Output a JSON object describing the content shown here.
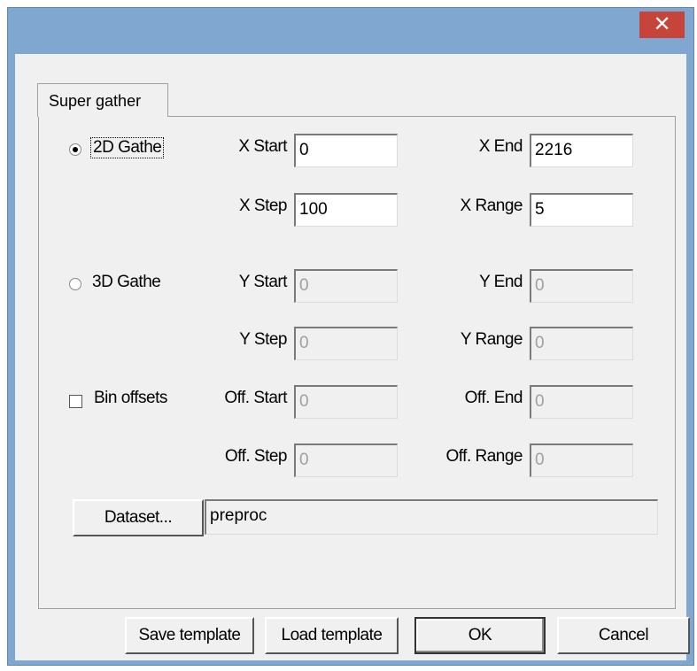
{
  "window": {
    "close_glyph": "✕"
  },
  "tabs": [
    {
      "label": "Super gather",
      "selected": true
    }
  ],
  "gather_mode": {
    "option_2d": {
      "label": "2D Gathe",
      "checked": true
    },
    "option_3d": {
      "label": "3D Gathe",
      "checked": false
    }
  },
  "x_params": {
    "start_label": "X Start",
    "start_value": "0",
    "end_label": "X End",
    "end_value": "2216",
    "step_label": "X Step",
    "step_value": "100",
    "range_label": "X Range",
    "range_value": "5"
  },
  "y_params": {
    "start_label": "Y Start",
    "start_value": "0",
    "end_label": "Y End",
    "end_value": "0",
    "step_label": "Y Step",
    "step_value": "0",
    "range_label": "Y Range",
    "range_value": "0"
  },
  "offsets": {
    "checkbox_label": "Bin offsets",
    "checked": false,
    "start_label": "Off. Start",
    "start_value": "0",
    "end_label": "Off. End",
    "end_value": "0",
    "step_label": "Off. Step",
    "step_value": "0",
    "range_label": "Off. Range",
    "range_value": "0"
  },
  "dataset": {
    "button_label": "Dataset...",
    "value": "preproc"
  },
  "footer": {
    "save_label": "Save template",
    "load_label": "Load template",
    "ok_label": "OK",
    "cancel_label": "Cancel"
  }
}
